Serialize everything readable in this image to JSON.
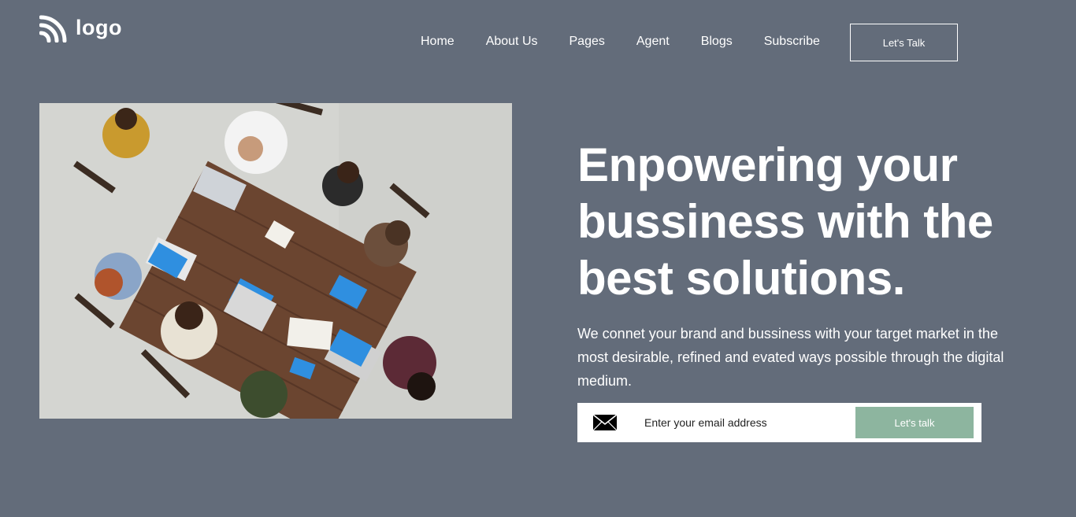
{
  "brand": {
    "logo_text": "logo",
    "logo_icon": "rss-icon"
  },
  "nav": {
    "items": [
      {
        "label": "Home"
      },
      {
        "label": "About Us"
      },
      {
        "label": "Pages"
      },
      {
        "label": "Agent"
      },
      {
        "label": "Blogs"
      },
      {
        "label": "Subscribe"
      }
    ],
    "cta_label": "Let's Talk"
  },
  "hero": {
    "title": "Enpowering your bussiness with the best solutions.",
    "subtitle": "We connet your brand and bussiness with your target market in the most desirable, refined and evated ways possible through the digital medium.",
    "email_placeholder": "Enter your email address",
    "email_icon": "mail-icon",
    "submit_label": "Let's talk"
  },
  "colors": {
    "background": "#636c7a",
    "text": "#ffffff",
    "accent_button": "#8db59f"
  }
}
